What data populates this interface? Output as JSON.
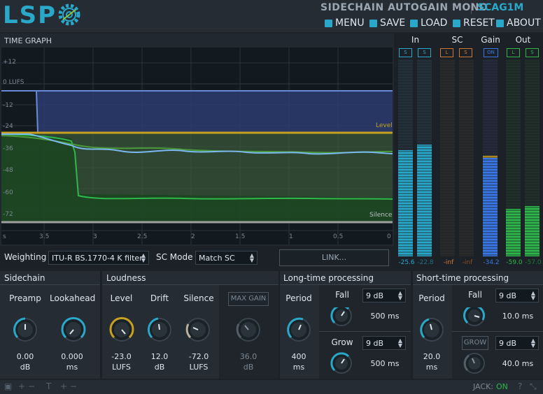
{
  "app": {
    "logo": "LSP",
    "title": "SIDECHAIN AUTOGAIN MONO",
    "plugin_id": "SCAG1M"
  },
  "menu": [
    {
      "label": "MENU",
      "icon": "menu-icon"
    },
    {
      "label": "SAVE",
      "icon": "save-icon"
    },
    {
      "label": "LOAD",
      "icon": "load-icon"
    },
    {
      "label": "RESET",
      "icon": "reset-icon"
    },
    {
      "label": "ABOUT",
      "icon": "about-icon"
    }
  ],
  "graph": {
    "title": "TIME GRAPH",
    "y_ticks": [
      "+12",
      "0 LUFS",
      "-12",
      "-24",
      "-36",
      "-48",
      "-60",
      "-72"
    ],
    "x_ticks": [
      "s",
      "3.5",
      "3",
      "2.5",
      "2",
      "1.5",
      "1",
      "0.5",
      "0"
    ],
    "level_label": "Level",
    "silence_label": "Silence",
    "colors": {
      "level_line": "#c8a020",
      "silence_line": "#a0a0a0",
      "gain_area": "#3a4e8c",
      "input_line": "#6aa8e8",
      "output_line": "#2fb84a"
    }
  },
  "controls": {
    "weighting_label": "Weighting",
    "weighting_value": "ITU-R BS.1770-4 K filter",
    "sc_mode_label": "SC Mode",
    "sc_mode_value": "Match SC",
    "link_label": "LINK..."
  },
  "meters": {
    "in": {
      "title": "In",
      "buttons": [
        "S",
        "S"
      ],
      "values": [
        "-25.6",
        "-22.8"
      ],
      "color": "#29a8c9"
    },
    "sc": {
      "title": "SC",
      "buttons": [
        "L",
        "S"
      ],
      "values": [
        "-inf",
        "-inf"
      ],
      "color": "#d07830"
    },
    "gain": {
      "title": "Gain",
      "buttons": [
        "ON"
      ],
      "values": [
        "-34.2"
      ],
      "color": "#3a78e8"
    },
    "out": {
      "title": "Out",
      "buttons": [
        "L",
        "S"
      ],
      "values": [
        "-59.0",
        "-57.0"
      ],
      "color": "#2fb84a"
    }
  },
  "sidechain": {
    "title": "Sidechain",
    "preamp": {
      "label": "Preamp",
      "value": "0.00",
      "unit": "dB"
    },
    "lookahead": {
      "label": "Lookahead",
      "value": "0.000",
      "unit": "ms"
    }
  },
  "loudness": {
    "title": "Loudness",
    "level": {
      "label": "Level",
      "value": "-23.0",
      "unit": "LUFS"
    },
    "drift": {
      "label": "Drift",
      "value": "12.0",
      "unit": "dB"
    },
    "silence": {
      "label": "Silence",
      "value": "-72.0",
      "unit": "LUFS"
    },
    "max_gain": {
      "label": "MAX GAIN",
      "value": "36.0",
      "unit": "dB"
    }
  },
  "long_time": {
    "title": "Long-time processing",
    "period": {
      "label": "Period",
      "value": "400",
      "unit": "ms"
    },
    "fall": {
      "label": "Fall",
      "combo": "9 dB",
      "value": "500 ms"
    },
    "grow": {
      "label": "Grow",
      "combo": "9 dB",
      "value": "500 ms"
    }
  },
  "short_time": {
    "title": "Short-time processing",
    "period": {
      "label": "Period",
      "value": "20.0",
      "unit": "ms"
    },
    "fall": {
      "label": "Fall",
      "combo": "9 dB",
      "value": "10.0 ms"
    },
    "grow": {
      "label": "GROW",
      "combo": "9 dB",
      "value": "40.0 ms"
    }
  },
  "status": {
    "jack_label": "JACK:",
    "jack_state": "ON"
  }
}
